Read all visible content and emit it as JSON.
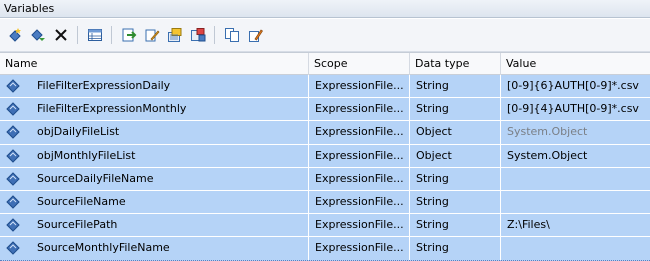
{
  "panel": {
    "title": "Variables"
  },
  "toolbar": {
    "buttons": [
      {
        "icon": "add-variable-icon"
      },
      {
        "icon": "move-variable-icon"
      },
      {
        "icon": "delete-icon"
      },
      {
        "icon": "grid-options-icon"
      },
      {
        "icon": "evaluate-expression-icon"
      },
      {
        "icon": "edit-expression-icon"
      },
      {
        "icon": "show-all-icon"
      },
      {
        "icon": "show-system-icon"
      },
      {
        "icon": "copy-icon"
      },
      {
        "icon": "paste-icon"
      }
    ]
  },
  "grid": {
    "columns": [
      "Name",
      "Scope",
      "Data type",
      "Value"
    ],
    "rows": [
      {
        "name": "FileFilterExpressionDaily",
        "scope": "ExpressionFile...",
        "type": "String",
        "value": "[0-9]{6}AUTH[0-9]*.csv",
        "muted": false
      },
      {
        "name": "FileFilterExpressionMonthly",
        "scope": "ExpressionFile...",
        "type": "String",
        "value": "[0-9]{4}AUTH[0-9]*.csv",
        "muted": false
      },
      {
        "name": "objDailyFileList",
        "scope": "ExpressionFile...",
        "type": "Object",
        "value": "System.Object",
        "muted": true
      },
      {
        "name": "objMonthlyFileList",
        "scope": "ExpressionFile...",
        "type": "Object",
        "value": "System.Object",
        "muted": false
      },
      {
        "name": "SourceDailyFileName",
        "scope": "ExpressionFile...",
        "type": "String",
        "value": "",
        "muted": false
      },
      {
        "name": "SourceFileName",
        "scope": "ExpressionFile...",
        "type": "String",
        "value": "",
        "muted": false
      },
      {
        "name": "SourceFilePath",
        "scope": "ExpressionFile...",
        "type": "String",
        "value": "Z:\\Files\\",
        "muted": false
      },
      {
        "name": "SourceMonthlyFileName",
        "scope": "ExpressionFile...",
        "type": "String",
        "value": "",
        "muted": false
      }
    ]
  },
  "colors": {
    "row_selected": "#b5d3f7",
    "icon_blue": "#3f6fb5",
    "muted_text": "#7a7f86"
  }
}
